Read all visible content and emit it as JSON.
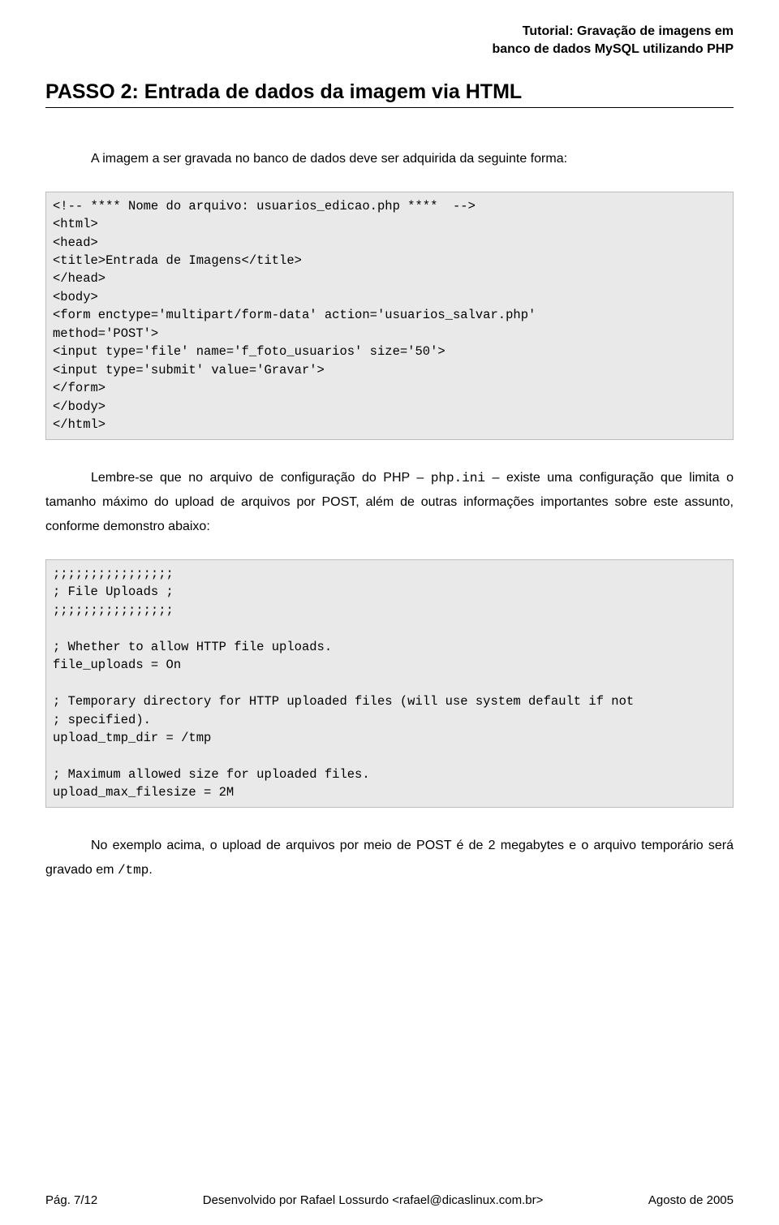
{
  "header": {
    "line1": "Tutorial: Gravação de imagens em",
    "line2": "banco de dados MySQL utilizando PHP"
  },
  "section_title": "PASSO 2: Entrada de dados da imagem via HTML",
  "intro_para": "A imagem a ser gravada no banco de dados deve ser adquirida da seguinte forma:",
  "code_block_1": "<!-- **** Nome do arquivo: usuarios_edicao.php ****  -->\n<html>\n<head>\n<title>Entrada de Imagens</title>\n</head>\n<body>\n<form enctype='multipart/form-data' action='usuarios_salvar.php'\nmethod='POST'>\n<input type='file' name='f_foto_usuarios' size='50'>\n<input type='submit' value='Gravar'>\n</form>\n</body>\n</html>",
  "para2_pre": "Lembre-se que no arquivo de configuração do PHP – ",
  "para2_code": "php.ini",
  "para2_post": " – existe uma configuração que limita o tamanho máximo do upload de arquivos por POST, além de outras informações importantes sobre este assunto, conforme demonstro abaixo:",
  "code_block_2": ";;;;;;;;;;;;;;;;\n; File Uploads ;\n;;;;;;;;;;;;;;;;\n\n; Whether to allow HTTP file uploads.\nfile_uploads = On\n\n; Temporary directory for HTTP uploaded files (will use system default if not\n; specified).\nupload_tmp_dir = /tmp\n\n; Maximum allowed size for uploaded files.\nupload_max_filesize = 2M",
  "para3_pre": "No exemplo acima, o upload de arquivos por meio de POST é de 2 megabytes e o arquivo temporário será gravado em ",
  "para3_code": "/tmp",
  "para3_post": ".",
  "footer": {
    "left": "Pág. 7/12",
    "center": "Desenvolvido por Rafael Lossurdo <rafael@dicaslinux.com.br>",
    "right": "Agosto de 2005"
  }
}
